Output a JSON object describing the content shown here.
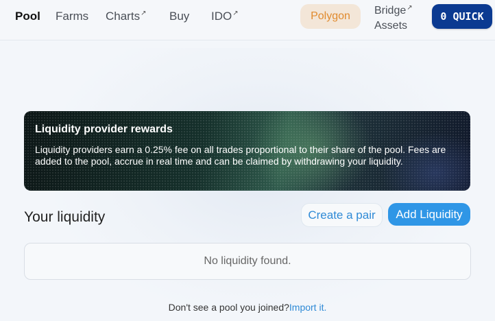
{
  "nav": {
    "items": [
      {
        "label": "Pool",
        "active": true,
        "external": false
      },
      {
        "label": "Farms",
        "active": false,
        "external": false
      },
      {
        "label": "Charts",
        "active": false,
        "external": true
      },
      {
        "label": "Buy",
        "active": false,
        "external": false
      },
      {
        "label": "IDO",
        "active": false,
        "external": true
      }
    ],
    "network_label": "Polygon",
    "bridge_line1": "Bridge",
    "bridge_line2": "Assets",
    "quick_balance": "0",
    "quick_symbol": "QUICK",
    "external_icon": "↗"
  },
  "banner": {
    "title": "Liquidity provider rewards",
    "text": "Liquidity providers earn a 0.25% fee on all trades proportional to their share of the pool. Fees are added to the pool, accrue in real time and can be claimed by withdrawing your liquidity."
  },
  "liquidity": {
    "heading": "Your liquidity",
    "create_pair_label": "Create a pair",
    "add_liquidity_label": "Add Liquidity",
    "empty_message": "No liquidity found."
  },
  "footer": {
    "prompt": "Don't see a pool you joined?",
    "import_link": "Import it."
  },
  "colors": {
    "accent": "#2f96e6",
    "quick_button": "#0b3a91",
    "network_text": "#e08a2e"
  }
}
